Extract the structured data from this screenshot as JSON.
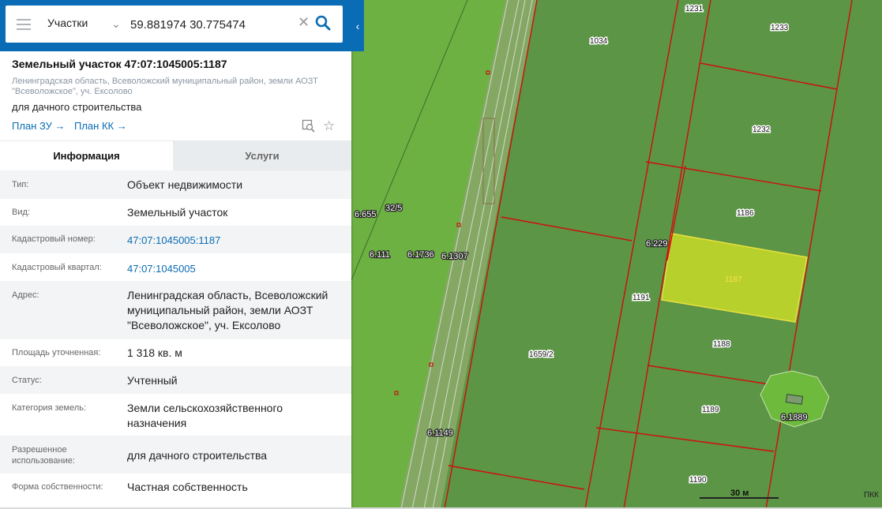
{
  "search": {
    "category": "Участки",
    "query": "59.881974 30.775474",
    "clear_icon": "close-icon",
    "search_icon": "magnifier-icon"
  },
  "parcel": {
    "title": "Земельный участок 47:07:1045005:1187",
    "address_header": "Ленинградская область, Всеволожский муниципальный район, земли АОЗТ \"Всеволожское\", уч. Ексолово",
    "purpose": "для дачного строительства",
    "link_plan_zu": "План ЗУ →",
    "link_plan_kk": "План КК →"
  },
  "tabs": {
    "info": "Информация",
    "services": "Услуги"
  },
  "info_rows": [
    {
      "label": "Тип:",
      "value": "Объект недвижимости"
    },
    {
      "label": "Вид:",
      "value": "Земельный участок"
    },
    {
      "label": "Кадастровый номер:",
      "value": "47:07:1045005:1187"
    },
    {
      "label": "Кадастровый квартал:",
      "value": "47:07:1045005"
    },
    {
      "label": "Адрес:",
      "value": "Ленинградская область, Всеволожский муниципальный район, земли АОЗТ \"Всеволожское\", уч. Ексолово"
    },
    {
      "label": "Площадь уточненная:",
      "value": "1 318 кв. м"
    },
    {
      "label": "Статус:",
      "value": "Учтенный"
    },
    {
      "label": "Категория земель:",
      "value": "Земли сельскохозяйственного назначения"
    },
    {
      "label": "Разрешенное использование:",
      "value": "для дачного строительства"
    },
    {
      "label": "Форма собственности:",
      "value": "Частная собственность"
    }
  ],
  "map": {
    "plot_labels": [
      "1231",
      "1233",
      "1034",
      "1232",
      "1186",
      "1187",
      "1191",
      "1188",
      "1189",
      "1190",
      "1659/2"
    ],
    "zone_labels": [
      "32/5",
      "6.655",
      "6.111",
      "6.1736",
      "6.1307",
      "6.229",
      "6.1149",
      "6.1889"
    ],
    "scale_label": "30 м",
    "attribution": "ПКК",
    "colors": {
      "land": "#6eb143",
      "parcels": "#5b9545",
      "selected": "#b7d02c",
      "boundary": "#d10d0d"
    }
  }
}
